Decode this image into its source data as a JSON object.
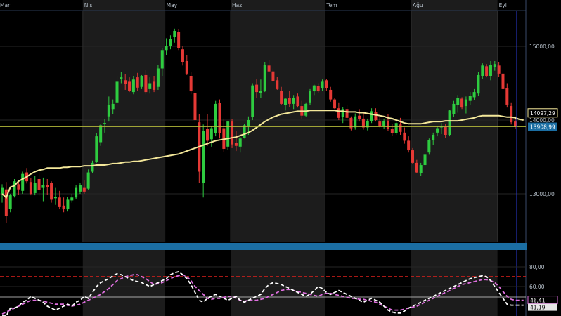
{
  "chart_data": [
    {
      "type": "candlestick",
      "x_months": [
        {
          "label": "Mar",
          "at_index": 0
        },
        {
          "label": "Nis",
          "at_index": 20
        },
        {
          "label": "May",
          "at_index": 40
        },
        {
          "label": "Haz",
          "at_index": 56
        },
        {
          "label": "Tem",
          "at_index": 79
        },
        {
          "label": "Ağu",
          "at_index": 100
        },
        {
          "label": "Eyl",
          "at_index": 121
        }
      ],
      "y_ticks": [
        {
          "value": 15000,
          "label": "15000,00"
        },
        {
          "value": 14000,
          "label": "14000,00"
        },
        {
          "value": 13000,
          "label": "13000,00"
        }
      ],
      "ylim": [
        12700,
        15500
      ],
      "grid": true,
      "current_price": {
        "value": 13908.99,
        "label": "13908,99"
      },
      "moving_average": {
        "last_value": 14097.29,
        "label": "14097,29"
      },
      "ohlc": [
        [
          13000,
          13130,
          12880,
          13080
        ],
        [
          13060,
          13160,
          12600,
          12700
        ],
        [
          12800,
          13000,
          12750,
          12980
        ],
        [
          12970,
          13200,
          12950,
          13170
        ],
        [
          13130,
          13190,
          12990,
          13060
        ],
        [
          13040,
          13300,
          13000,
          13270
        ],
        [
          13290,
          13350,
          13140,
          13170
        ],
        [
          13160,
          13210,
          12980,
          13000
        ],
        [
          13010,
          13240,
          12980,
          13150
        ],
        [
          13200,
          13290,
          12970,
          13050
        ],
        [
          13080,
          13220,
          12900,
          13120
        ],
        [
          13120,
          13200,
          12990,
          13090
        ],
        [
          13150,
          13170,
          12880,
          12920
        ],
        [
          12940,
          13080,
          12850,
          12960
        ],
        [
          12950,
          13040,
          12790,
          12820
        ],
        [
          12840,
          12950,
          12750,
          12800
        ],
        [
          12790,
          12960,
          12760,
          12920
        ],
        [
          12910,
          13000,
          12880,
          12950
        ],
        [
          12950,
          13120,
          12930,
          13080
        ],
        [
          13030,
          13150,
          13000,
          13120
        ],
        [
          13080,
          13180,
          13000,
          13030
        ],
        [
          13070,
          13330,
          13050,
          13290
        ],
        [
          13300,
          13450,
          13280,
          13420
        ],
        [
          13430,
          13820,
          13420,
          13780
        ],
        [
          13700,
          13950,
          13650,
          13930
        ],
        [
          13950,
          14010,
          13830,
          13960
        ],
        [
          14050,
          14320,
          13980,
          14200
        ],
        [
          14150,
          14280,
          14080,
          14220
        ],
        [
          14240,
          14600,
          14180,
          14520
        ],
        [
          14560,
          14650,
          14500,
          14580
        ],
        [
          14540,
          14620,
          14410,
          14490
        ],
        [
          14520,
          14580,
          14380,
          14400
        ],
        [
          14380,
          14600,
          14350,
          14550
        ],
        [
          14580,
          14640,
          14400,
          14440
        ],
        [
          14450,
          14610,
          14420,
          14600
        ],
        [
          14610,
          14680,
          14350,
          14380
        ],
        [
          14420,
          14580,
          14360,
          14500
        ],
        [
          14520,
          14600,
          14380,
          14410
        ],
        [
          14450,
          14750,
          14410,
          14700
        ],
        [
          14700,
          14980,
          14600,
          14950
        ],
        [
          14950,
          15110,
          14880,
          15000
        ],
        [
          15000,
          15150,
          14960,
          15100
        ],
        [
          15130,
          15240,
          15050,
          15210
        ],
        [
          15200,
          15230,
          14950,
          14980
        ],
        [
          14960,
          15000,
          14740,
          14790
        ],
        [
          14800,
          14880,
          14610,
          14630
        ],
        [
          14600,
          14650,
          14350,
          14390
        ],
        [
          14370,
          14460,
          13950,
          14000
        ],
        [
          13970,
          14080,
          13150,
          13300
        ],
        [
          13150,
          13940,
          12950,
          13850
        ],
        [
          13880,
          14080,
          13650,
          13720
        ],
        [
          13740,
          13920,
          13640,
          13890
        ],
        [
          13820,
          14260,
          13780,
          14220
        ],
        [
          14230,
          14280,
          13750,
          13820
        ],
        [
          13890,
          14020,
          13570,
          13610
        ],
        [
          13640,
          13980,
          13600,
          13980
        ],
        [
          13980,
          14010,
          13620,
          13670
        ],
        [
          13690,
          13850,
          13580,
          13650
        ],
        [
          13640,
          13770,
          13560,
          13750
        ],
        [
          13760,
          13950,
          13750,
          13930
        ],
        [
          13920,
          14050,
          13800,
          14000
        ],
        [
          14040,
          14500,
          14000,
          14470
        ],
        [
          14480,
          14560,
          14300,
          14380
        ],
        [
          14370,
          14550,
          14300,
          14400
        ],
        [
          14400,
          14790,
          14380,
          14750
        ],
        [
          14740,
          14810,
          14650,
          14660
        ],
        [
          14660,
          14700,
          14520,
          14530
        ],
        [
          14540,
          14590,
          14410,
          14420
        ],
        [
          14400,
          14450,
          14200,
          14220
        ],
        [
          14200,
          14300,
          14130,
          14290
        ],
        [
          14300,
          14400,
          14180,
          14220
        ],
        [
          14220,
          14340,
          14150,
          14300
        ],
        [
          14320,
          14360,
          14170,
          14190
        ],
        [
          14190,
          14260,
          14020,
          14060
        ],
        [
          14060,
          14240,
          14040,
          14220
        ],
        [
          14240,
          14420,
          14200,
          14390
        ],
        [
          14390,
          14480,
          14340,
          14470
        ],
        [
          14460,
          14500,
          14370,
          14390
        ],
        [
          14430,
          14550,
          14400,
          14520
        ],
        [
          14540,
          14560,
          14400,
          14430
        ],
        [
          14410,
          14450,
          14250,
          14280
        ],
        [
          14280,
          14300,
          14150,
          14160
        ],
        [
          14160,
          14240,
          14000,
          14030
        ],
        [
          14040,
          14180,
          13960,
          14150
        ],
        [
          14150,
          14210,
          14010,
          14030
        ],
        [
          14030,
          14050,
          13860,
          13890
        ],
        [
          13900,
          14090,
          13870,
          14050
        ],
        [
          14060,
          14150,
          13980,
          14010
        ],
        [
          14020,
          14090,
          13870,
          13900
        ],
        [
          13900,
          14020,
          13860,
          13990
        ],
        [
          13990,
          14160,
          13960,
          14120
        ],
        [
          14110,
          14160,
          13980,
          14000
        ],
        [
          13980,
          14050,
          13900,
          13920
        ],
        [
          13920,
          14020,
          13880,
          13990
        ],
        [
          13990,
          14080,
          13850,
          13880
        ],
        [
          13880,
          13950,
          13790,
          13820
        ],
        [
          13820,
          13980,
          13800,
          13960
        ],
        [
          13940,
          14030,
          13800,
          13840
        ],
        [
          13830,
          13900,
          13680,
          13720
        ],
        [
          13720,
          13780,
          13560,
          13590
        ],
        [
          13590,
          13620,
          13400,
          13420
        ],
        [
          13420,
          13460,
          13280,
          13290
        ],
        [
          13280,
          13420,
          13240,
          13390
        ],
        [
          13390,
          13550,
          13360,
          13530
        ],
        [
          13560,
          13750,
          13530,
          13730
        ],
        [
          13730,
          13830,
          13660,
          13800
        ],
        [
          13830,
          13920,
          13780,
          13890
        ],
        [
          13900,
          13960,
          13810,
          13920
        ],
        [
          13910,
          13950,
          13760,
          13800
        ],
        [
          13800,
          14140,
          13780,
          14130
        ],
        [
          14080,
          14260,
          14040,
          14220
        ],
        [
          14200,
          14340,
          14100,
          14300
        ],
        [
          14290,
          14310,
          14150,
          14170
        ],
        [
          14190,
          14320,
          14090,
          14280
        ],
        [
          14260,
          14380,
          14200,
          14330
        ],
        [
          14310,
          14420,
          14270,
          14380
        ],
        [
          14360,
          14650,
          14330,
          14610
        ],
        [
          14600,
          14770,
          14560,
          14740
        ],
        [
          14730,
          14760,
          14580,
          14600
        ],
        [
          14600,
          14800,
          14540,
          14750
        ],
        [
          14720,
          14800,
          14670,
          14760
        ],
        [
          14740,
          14790,
          14590,
          14630
        ],
        [
          14630,
          14690,
          14400,
          14420
        ],
        [
          14430,
          14500,
          14170,
          14210
        ],
        [
          14190,
          14240,
          13940,
          13970
        ],
        [
          13980,
          14050,
          13880,
          13910
        ]
      ],
      "ma_values": [
        13000,
        12950,
        13090,
        13110,
        13170,
        13200,
        13230,
        13270,
        13300,
        13320,
        13330,
        13350,
        13350,
        13350,
        13350,
        13360,
        13360,
        13370,
        13370,
        13370,
        13380,
        13380,
        13380,
        13390,
        13390,
        13390,
        13400,
        13410,
        13410,
        13420,
        13430,
        13430,
        13440,
        13440,
        13450,
        13460,
        13470,
        13480,
        13490,
        13500,
        13510,
        13520,
        13530,
        13540,
        13560,
        13580,
        13600,
        13620,
        13640,
        13660,
        13680,
        13700,
        13720,
        13730,
        13740,
        13750,
        13760,
        13770,
        13790,
        13810,
        13830,
        13860,
        13900,
        13940,
        13980,
        14010,
        14040,
        14060,
        14080,
        14090,
        14100,
        14110,
        14120,
        14120,
        14120,
        14130,
        14130,
        14130,
        14130,
        14130,
        14130,
        14130,
        14120,
        14120,
        14110,
        14110,
        14110,
        14100,
        14100,
        14090,
        14080,
        14070,
        14060,
        14050,
        14030,
        14020,
        14000,
        13980,
        13960,
        13950,
        13950,
        13950,
        13950,
        13960,
        13970,
        13980,
        13980,
        13980,
        13990,
        13990,
        13990,
        13990,
        14000,
        14010,
        14020,
        14030,
        14050,
        14060,
        14060,
        14060,
        14060,
        14060,
        14050,
        14040,
        14040,
        14030,
        14010,
        14000
      ]
    },
    {
      "type": "line",
      "y_ticks": [
        {
          "value": 80,
          "label": "80,00"
        },
        {
          "value": 60,
          "label": "60,00"
        }
      ],
      "ylim": [
        30,
        90
      ],
      "reference_line": 70,
      "series": [
        {
          "label": "46,41",
          "color": "#e070e0",
          "values": [
            32,
            34,
            36,
            38,
            40,
            42,
            44,
            46,
            46,
            46,
            45,
            44,
            43,
            42,
            42,
            42,
            41,
            40,
            41,
            42,
            44,
            46,
            48,
            50,
            52,
            55,
            58,
            62,
            66,
            68,
            70,
            71,
            72,
            72,
            70,
            68,
            65,
            62,
            63,
            64,
            66,
            68,
            70,
            71,
            72,
            70,
            66,
            60,
            56,
            52,
            48,
            47,
            48,
            48,
            49,
            50,
            50,
            48,
            46,
            45,
            46,
            46,
            46,
            47,
            48,
            50,
            52,
            54,
            56,
            57,
            57,
            56,
            55,
            54,
            53,
            52,
            51,
            50,
            52,
            53,
            53,
            52,
            51,
            50,
            49,
            48,
            48,
            47,
            47,
            46,
            45,
            44,
            42,
            40,
            38,
            36,
            36,
            36,
            37,
            38,
            39,
            40,
            42,
            44,
            46,
            48,
            50,
            52,
            54,
            56,
            58,
            60,
            62,
            63,
            64,
            65,
            66,
            67,
            67,
            66,
            64,
            60,
            55,
            50,
            47,
            46,
            46,
            46
          ]
        },
        {
          "label": "41,19",
          "color": "#ffffff",
          "values": [
            30,
            30,
            38,
            38,
            40,
            44,
            46,
            50,
            48,
            46,
            44,
            40,
            38,
            36,
            38,
            40,
            42,
            40,
            44,
            46,
            50,
            48,
            54,
            60,
            64,
            66,
            68,
            71,
            73,
            72,
            70,
            68,
            66,
            65,
            64,
            62,
            60,
            62,
            64,
            66,
            68,
            72,
            74,
            75,
            72,
            68,
            62,
            54,
            46,
            44,
            48,
            50,
            52,
            50,
            48,
            46,
            48,
            50,
            46,
            44,
            46,
            48,
            50,
            52,
            58,
            62,
            64,
            63,
            62,
            60,
            58,
            56,
            54,
            52,
            50,
            52,
            56,
            60,
            58,
            54,
            52,
            54,
            56,
            54,
            52,
            50,
            48,
            46,
            44,
            46,
            48,
            46,
            44,
            40,
            36,
            34,
            33,
            33,
            35,
            38,
            40,
            42,
            44,
            46,
            48,
            50,
            52,
            54,
            56,
            58,
            60,
            62,
            64,
            66,
            68,
            69,
            70,
            71,
            70,
            66,
            60,
            54,
            48,
            42,
            41,
            41,
            41,
            41
          ]
        }
      ]
    }
  ]
}
